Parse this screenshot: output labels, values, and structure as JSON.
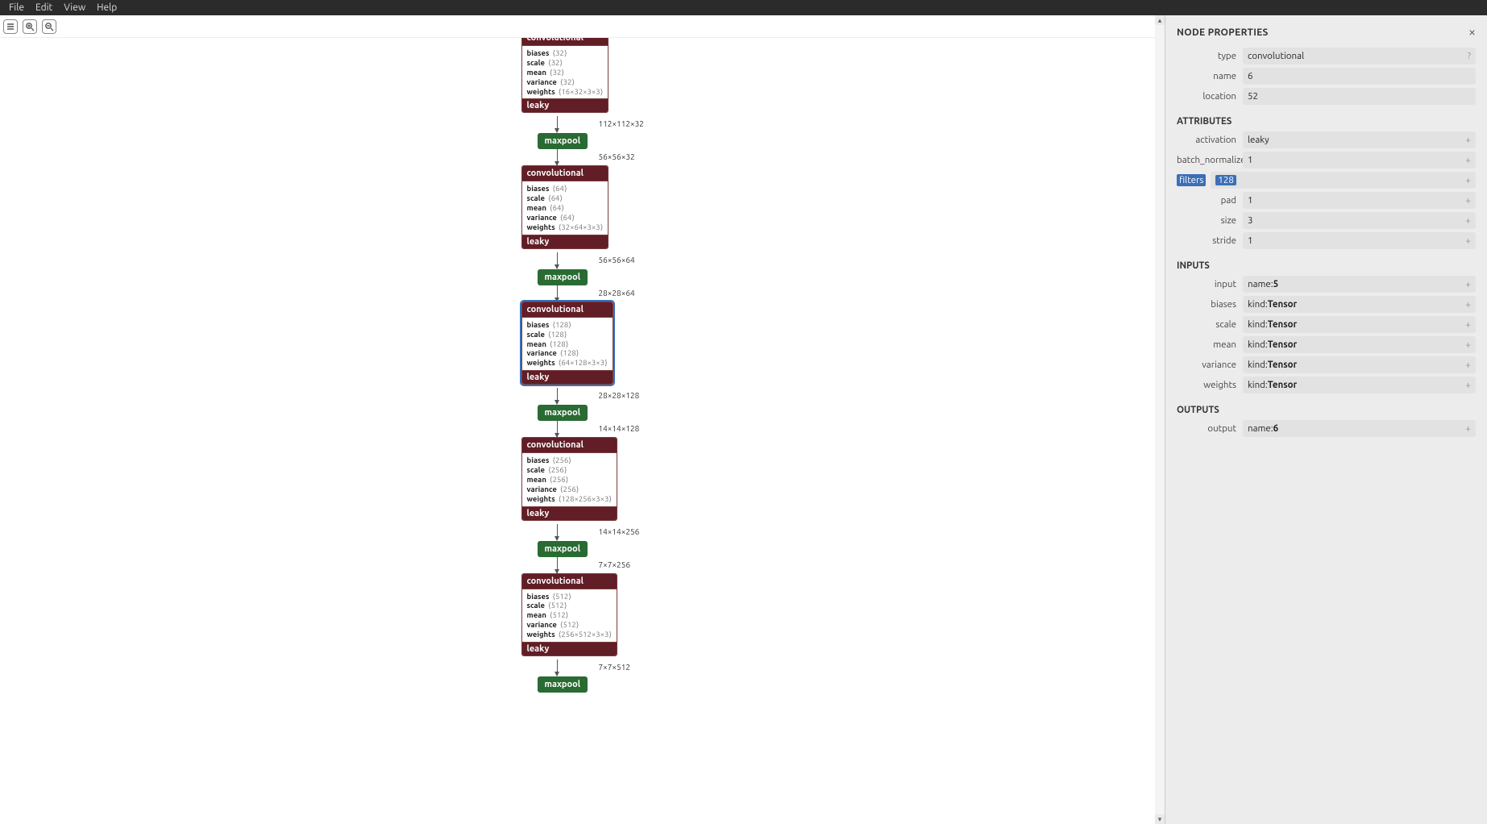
{
  "menubar": {
    "items": [
      "File",
      "Edit",
      "View",
      "Help"
    ]
  },
  "toolbar": {
    "icons": [
      "list-icon",
      "zoom-in-icon",
      "zoom-out-icon"
    ]
  },
  "graph": {
    "nodes": [
      {
        "kind": "conv",
        "header": "convolutional",
        "selected": false,
        "params": [
          {
            "name": "biases",
            "dim": "⟨32⟩"
          },
          {
            "name": "scale",
            "dim": "⟨32⟩"
          },
          {
            "name": "mean",
            "dim": "⟨32⟩"
          },
          {
            "name": "variance",
            "dim": "⟨32⟩"
          },
          {
            "name": "weights",
            "dim": "⟨16×32×3×3⟩"
          }
        ],
        "footer": "leaky",
        "edge_label": "112×112×32",
        "edge_h": 20
      },
      {
        "kind": "pool",
        "label": "maxpool",
        "edge_label": "56×56×32",
        "edge_h": 20
      },
      {
        "kind": "conv",
        "header": "convolutional",
        "selected": false,
        "params": [
          {
            "name": "biases",
            "dim": "⟨64⟩"
          },
          {
            "name": "scale",
            "dim": "⟨64⟩"
          },
          {
            "name": "mean",
            "dim": "⟨64⟩"
          },
          {
            "name": "variance",
            "dim": "⟨64⟩"
          },
          {
            "name": "weights",
            "dim": "⟨32×64×3×3⟩"
          }
        ],
        "footer": "leaky",
        "edge_label": "56×56×64",
        "edge_h": 20
      },
      {
        "kind": "pool",
        "label": "maxpool",
        "edge_label": "28×28×64",
        "edge_h": 20
      },
      {
        "kind": "conv",
        "header": "convolutional",
        "selected": true,
        "params": [
          {
            "name": "biases",
            "dim": "⟨128⟩"
          },
          {
            "name": "scale",
            "dim": "⟨128⟩"
          },
          {
            "name": "mean",
            "dim": "⟨128⟩"
          },
          {
            "name": "variance",
            "dim": "⟨128⟩"
          },
          {
            "name": "weights",
            "dim": "⟨64×128×3×3⟩"
          }
        ],
        "footer": "leaky",
        "edge_label": "28×28×128",
        "edge_h": 20
      },
      {
        "kind": "pool",
        "label": "maxpool",
        "edge_label": "14×14×128",
        "edge_h": 20
      },
      {
        "kind": "conv",
        "header": "convolutional",
        "selected": false,
        "params": [
          {
            "name": "biases",
            "dim": "⟨256⟩"
          },
          {
            "name": "scale",
            "dim": "⟨256⟩"
          },
          {
            "name": "mean",
            "dim": "⟨256⟩"
          },
          {
            "name": "variance",
            "dim": "⟨256⟩"
          },
          {
            "name": "weights",
            "dim": "⟨128×256×3×3⟩"
          }
        ],
        "footer": "leaky",
        "edge_label": "14×14×256",
        "edge_h": 20
      },
      {
        "kind": "pool",
        "label": "maxpool",
        "edge_label": "7×7×256",
        "edge_h": 20
      },
      {
        "kind": "conv",
        "header": "convolutional",
        "selected": false,
        "params": [
          {
            "name": "biases",
            "dim": "⟨512⟩"
          },
          {
            "name": "scale",
            "dim": "⟨512⟩"
          },
          {
            "name": "mean",
            "dim": "⟨512⟩"
          },
          {
            "name": "variance",
            "dim": "⟨512⟩"
          },
          {
            "name": "weights",
            "dim": "⟨256×512×3×3⟩"
          }
        ],
        "footer": "leaky",
        "edge_label": "7×7×512",
        "edge_h": 20
      },
      {
        "kind": "pool",
        "label": "maxpool",
        "edge_label": "",
        "edge_h": 0
      }
    ]
  },
  "side": {
    "title": "NODE PROPERTIES",
    "close": "×",
    "meta": [
      {
        "label": "type",
        "value": "convolutional",
        "badge": "?",
        "plus": false
      },
      {
        "label": "name",
        "value": "6",
        "badge": "",
        "plus": false
      },
      {
        "label": "location",
        "value": "52",
        "badge": "",
        "plus": false
      }
    ],
    "attrs_title": "ATTRIBUTES",
    "attrs": [
      {
        "label": "activation",
        "value": "leaky",
        "highlight": false
      },
      {
        "label": "batch_normalize",
        "value": "1",
        "highlight": false
      },
      {
        "label": "filters",
        "value": "128",
        "highlight": true
      },
      {
        "label": "pad",
        "value": "1",
        "highlight": false
      },
      {
        "label": "size",
        "value": "3",
        "highlight": false
      },
      {
        "label": "stride",
        "value": "1",
        "highlight": false
      }
    ],
    "inputs_title": "INPUTS",
    "inputs": [
      {
        "label": "input",
        "prefix": "name: ",
        "value": "5"
      },
      {
        "label": "biases",
        "prefix": "kind: ",
        "value": "Tensor"
      },
      {
        "label": "scale",
        "prefix": "kind: ",
        "value": "Tensor"
      },
      {
        "label": "mean",
        "prefix": "kind: ",
        "value": "Tensor"
      },
      {
        "label": "variance",
        "prefix": "kind: ",
        "value": "Tensor"
      },
      {
        "label": "weights",
        "prefix": "kind: ",
        "value": "Tensor"
      }
    ],
    "outputs_title": "OUTPUTS",
    "outputs": [
      {
        "label": "output",
        "prefix": "name: ",
        "value": "6"
      }
    ]
  }
}
